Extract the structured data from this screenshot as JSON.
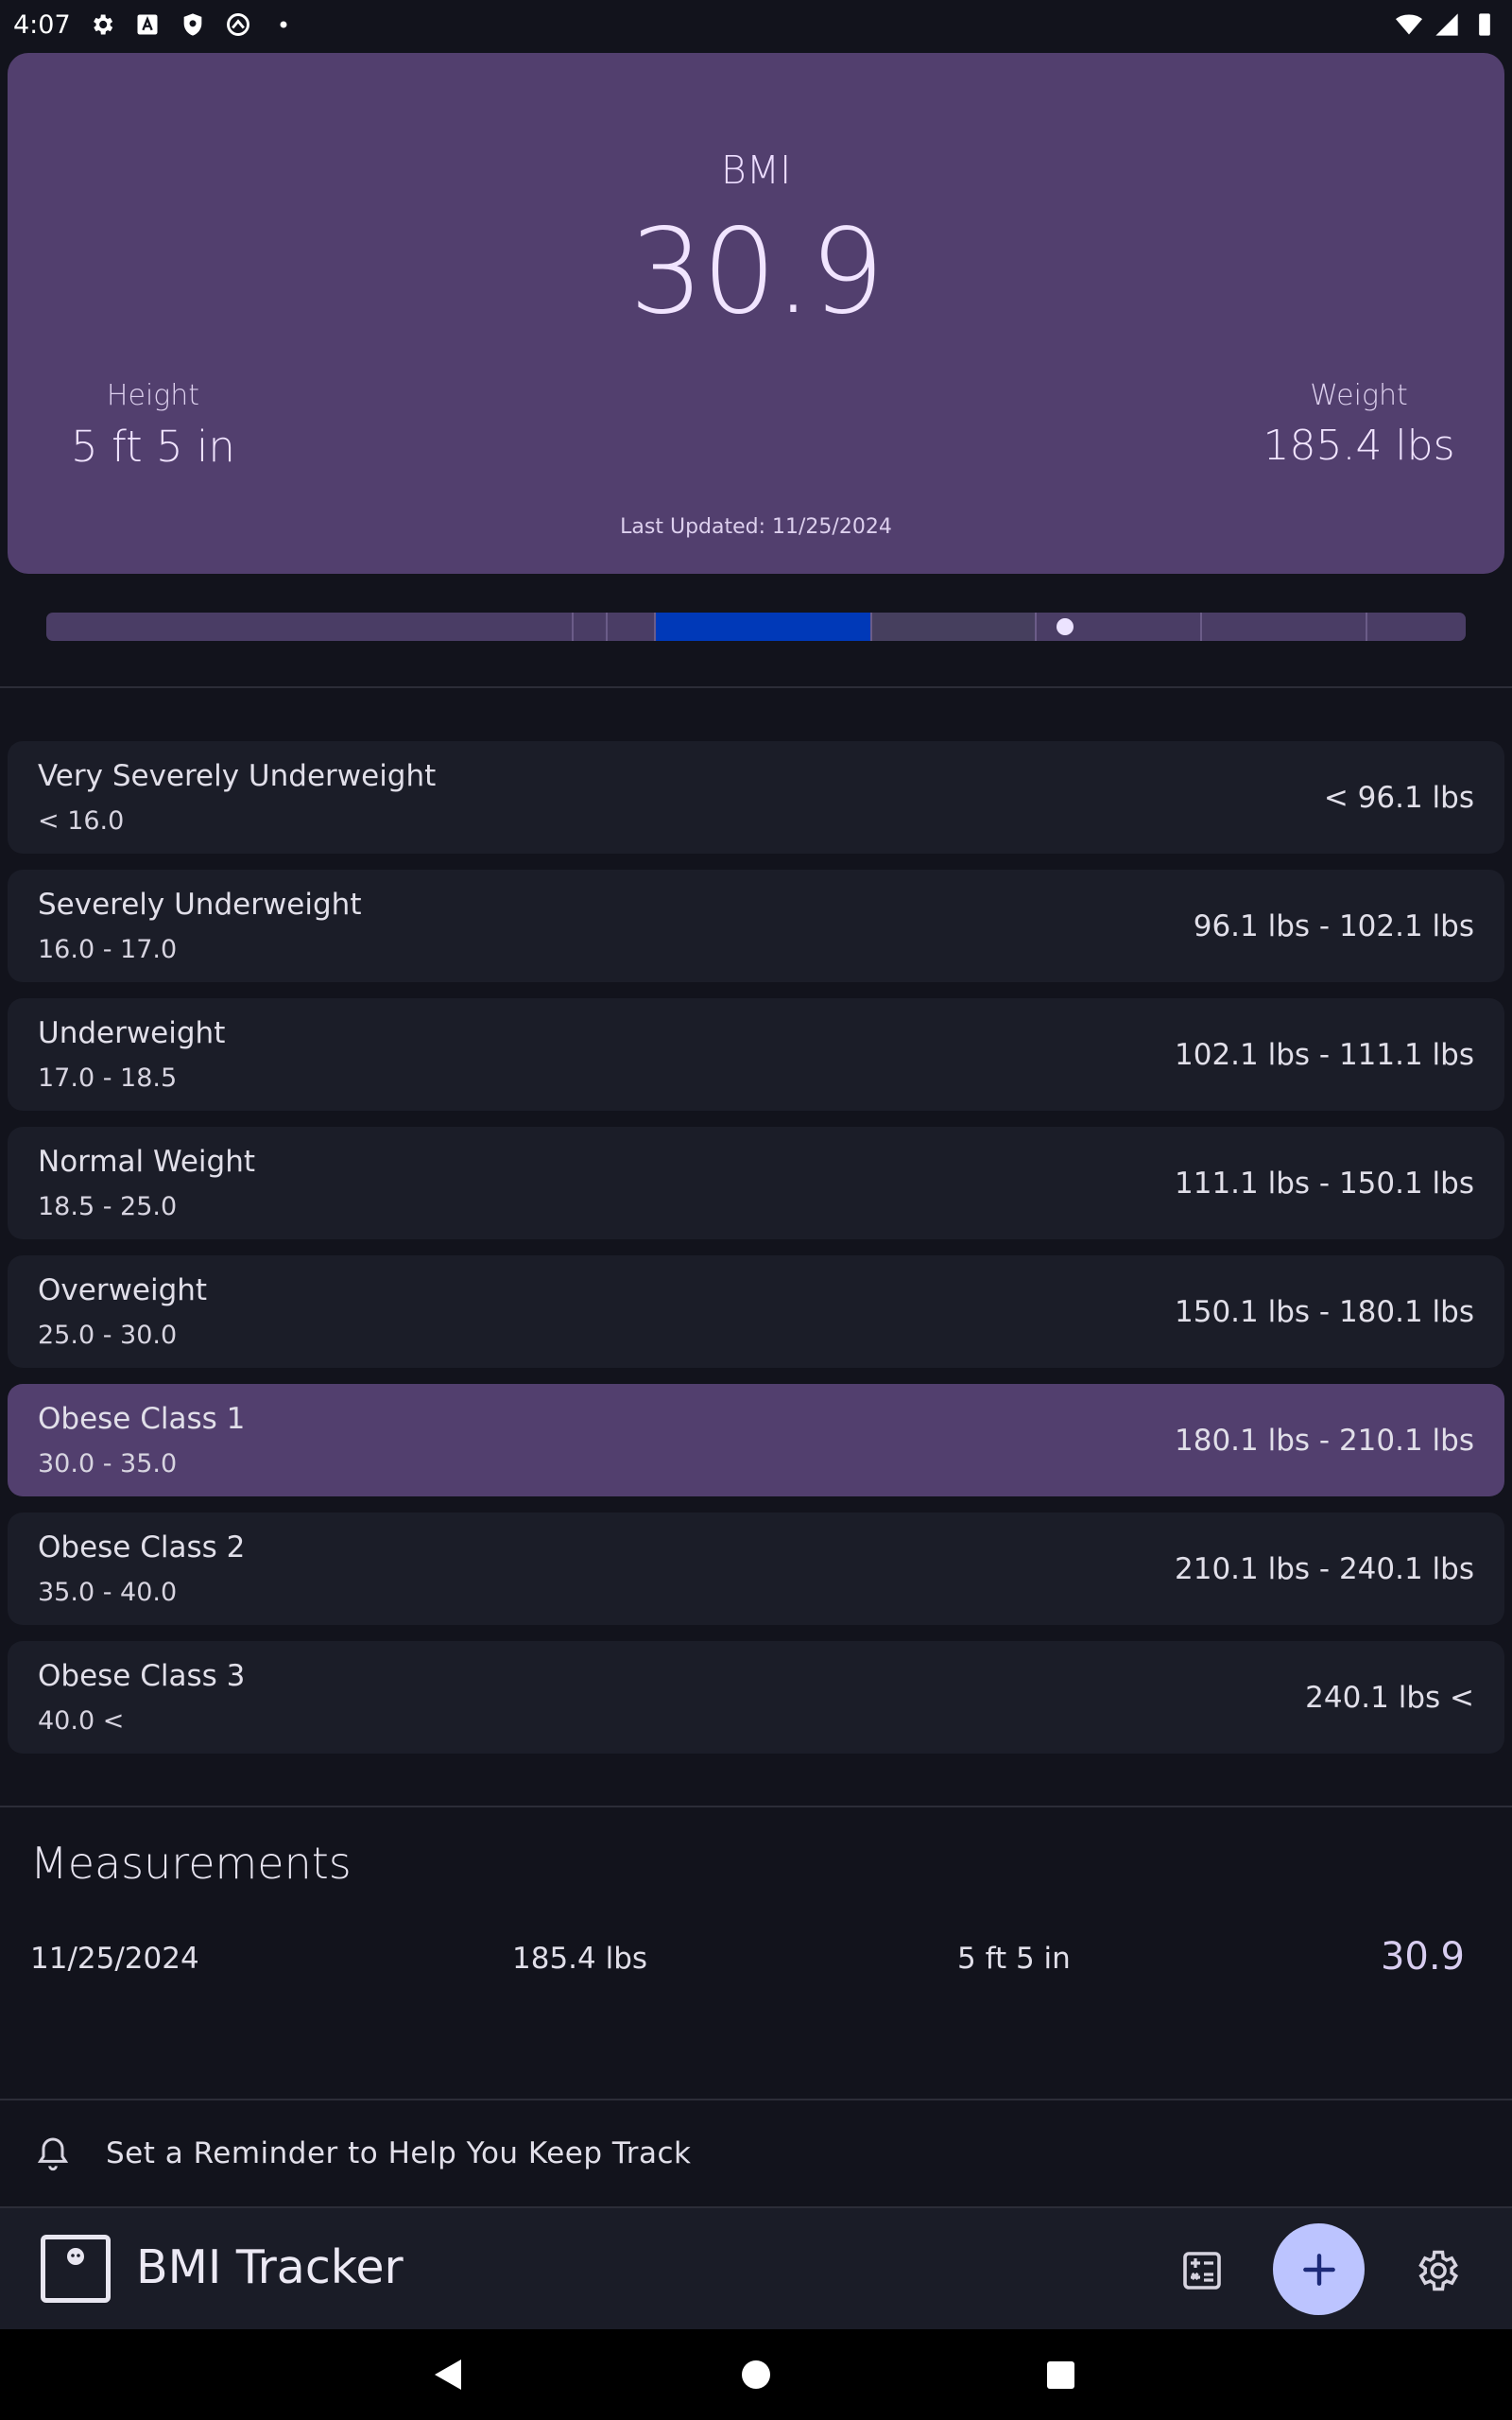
{
  "status_bar": {
    "time": "4:07"
  },
  "summary": {
    "bmi_label": "BMI",
    "bmi_value": "30.9",
    "height_label": "Height",
    "height_value": "5 ft 5 in",
    "weight_label": "Weight",
    "weight_value": "185.4 lbs",
    "last_updated": "Last Updated: 11/25/2024"
  },
  "scale": {
    "bmi_position": 30.9,
    "highlight_range": [
      18.5,
      25.0
    ],
    "highlight_color": "#0039b8",
    "track_color": "#4a3d65"
  },
  "categories": [
    {
      "name": "Very Severely Underweight",
      "range": "< 16.0",
      "weight": "< 96.1 lbs",
      "active": false
    },
    {
      "name": "Severely Underweight",
      "range": "16.0 - 17.0",
      "weight": "96.1 lbs - 102.1 lbs",
      "active": false
    },
    {
      "name": "Underweight",
      "range": "17.0 - 18.5",
      "weight": "102.1 lbs - 111.1 lbs",
      "active": false
    },
    {
      "name": "Normal Weight",
      "range": "18.5 - 25.0",
      "weight": "111.1 lbs - 150.1 lbs",
      "active": false
    },
    {
      "name": "Overweight",
      "range": "25.0 - 30.0",
      "weight": "150.1 lbs - 180.1 lbs",
      "active": false
    },
    {
      "name": "Obese Class 1",
      "range": "30.0 - 35.0",
      "weight": "180.1 lbs - 210.1 lbs",
      "active": true
    },
    {
      "name": "Obese Class 2",
      "range": "35.0 - 40.0",
      "weight": "210.1 lbs - 240.1 lbs",
      "active": false
    },
    {
      "name": "Obese Class 3",
      "range": "40.0 <",
      "weight": "240.1 lbs <",
      "active": false
    }
  ],
  "measurements": {
    "title": "Measurements",
    "rows": [
      {
        "date": "11/25/2024",
        "weight": "185.4 lbs",
        "height": "5 ft 5 in",
        "bmi": "30.9"
      }
    ]
  },
  "reminder": {
    "text": "Set a Reminder to Help You Keep Track"
  },
  "bottom_bar": {
    "app_title": "BMI Tracker"
  },
  "colors": {
    "background": "#12131c",
    "card": "#523f6e",
    "row": "#1b1d28",
    "fab": "#bcc4ff"
  }
}
